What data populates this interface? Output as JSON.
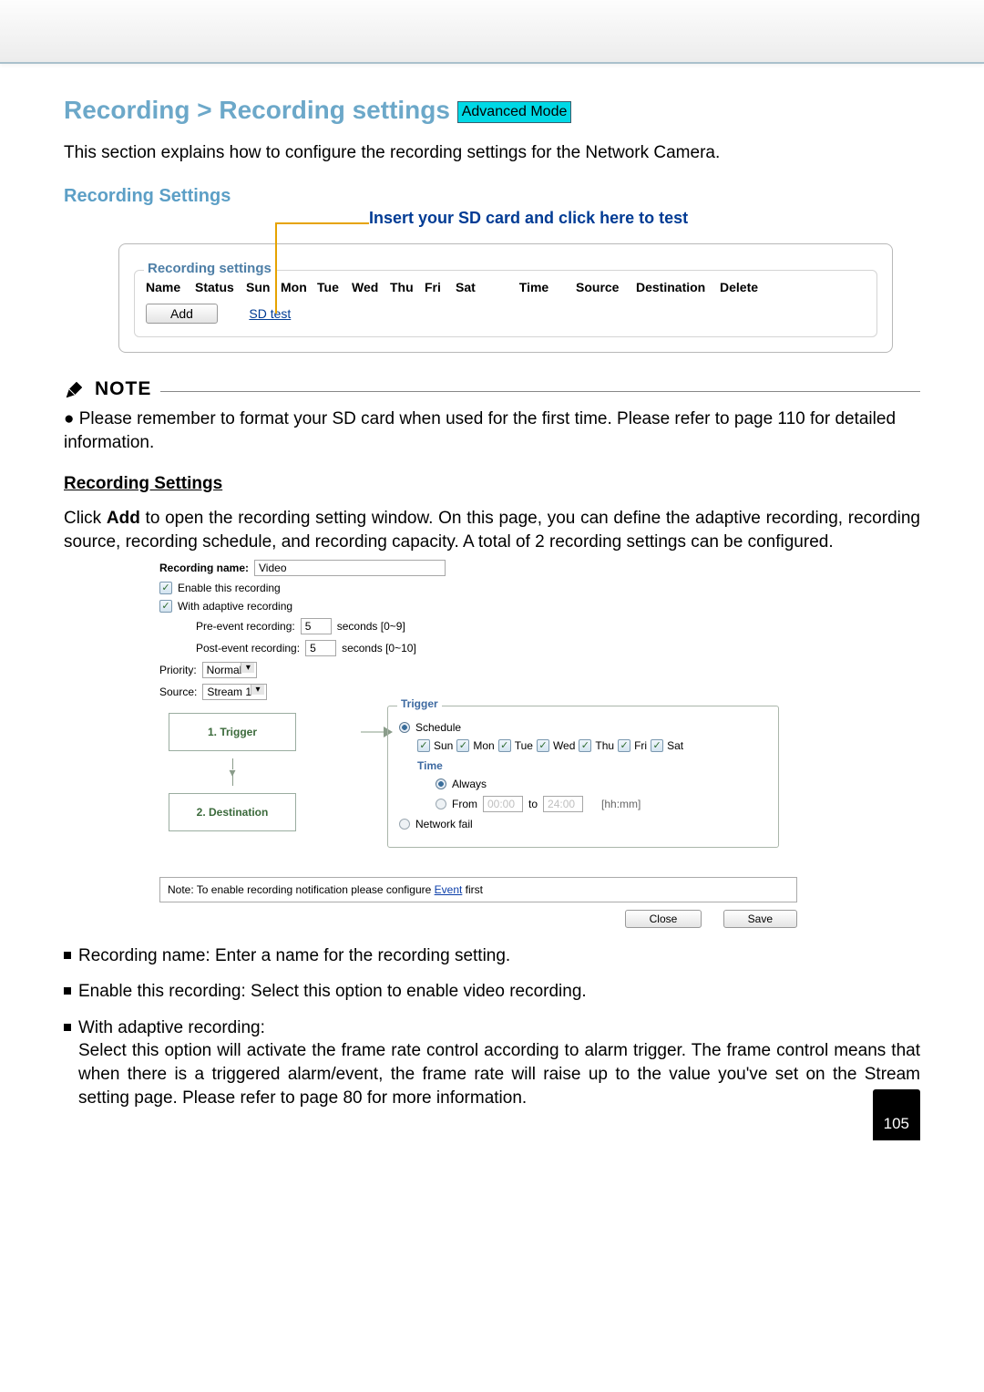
{
  "title": {
    "breadcrumb": "Recording > Recording settings",
    "mode_badge": "Advanced Mode"
  },
  "intro": "This section explains how to configure the recording settings for the Network Camera.",
  "section_subhead": "Recording Settings",
  "sd_hint": "Insert your SD card and click here to test",
  "panel": {
    "legend": "Recording settings",
    "cols": {
      "name": "Name",
      "status": "Status",
      "sun": "Sun",
      "mon": "Mon",
      "tue": "Tue",
      "wed": "Wed",
      "thu": "Thu",
      "fri": "Fri",
      "sat": "Sat",
      "time": "Time",
      "source": "Source",
      "destination": "Destination",
      "delete": "Delete"
    },
    "add_btn": "Add",
    "sd_test": "SD test"
  },
  "note": {
    "label": "NOTE",
    "bullet": "● Please remember to format your SD card when used for the first time. Please refer to page 110 for detailed information."
  },
  "rec_settings_head": "Recording Settings",
  "rec_settings_para_a": "Click ",
  "rec_settings_para_b": "Add",
  "rec_settings_para_c": " to open the recording setting window. On this page, you can define the adaptive recording, recording source, recording schedule, and recording capacity. A total of 2 recording settings can be configured.",
  "ss": {
    "recording_name_lbl": "Recording name:",
    "recording_name_val": "Video",
    "enable_lbl": "Enable this recording",
    "adaptive_lbl": "With adaptive recording",
    "pre_lbl": "Pre-event recording:",
    "pre_val": "5",
    "pre_unit": "seconds [0~9]",
    "post_lbl": "Post-event recording:",
    "post_val": "5",
    "post_unit": "seconds [0~10]",
    "priority_lbl": "Priority:",
    "priority_val": "Normal",
    "source_lbl": "Source:",
    "source_val": "Stream 1",
    "flow_trigger": "1.  Trigger",
    "flow_dest": "2.  Destination",
    "trigger_legend": "Trigger",
    "schedule": "Schedule",
    "days": {
      "sun": "Sun",
      "mon": "Mon",
      "tue": "Tue",
      "wed": "Wed",
      "thu": "Thu",
      "fri": "Fri",
      "sat": "Sat"
    },
    "time_lbl": "Time",
    "always": "Always",
    "from": "From",
    "from_val": "00:00",
    "to": "to",
    "to_val": "24:00",
    "hhmm": "[hh:mm]",
    "network_fail": "Network fail",
    "note_pre": "Note: To enable recording notification please configure ",
    "note_link": "Event",
    "note_post": " first",
    "close_btn": "Close",
    "save_btn": "Save"
  },
  "bullets": {
    "b1": "Recording name: Enter a name for the recording setting.",
    "b2": "Enable this recording: Select this option to enable video recording.",
    "b3a": "With adaptive recording:",
    "b3b": "Select this option will activate the frame rate control according to alarm trigger. The frame control means that when there is a triggered alarm/event, the frame rate will raise up to the value you've set on the Stream setting page. Please refer to page 80 for more information."
  },
  "page_num": "105"
}
